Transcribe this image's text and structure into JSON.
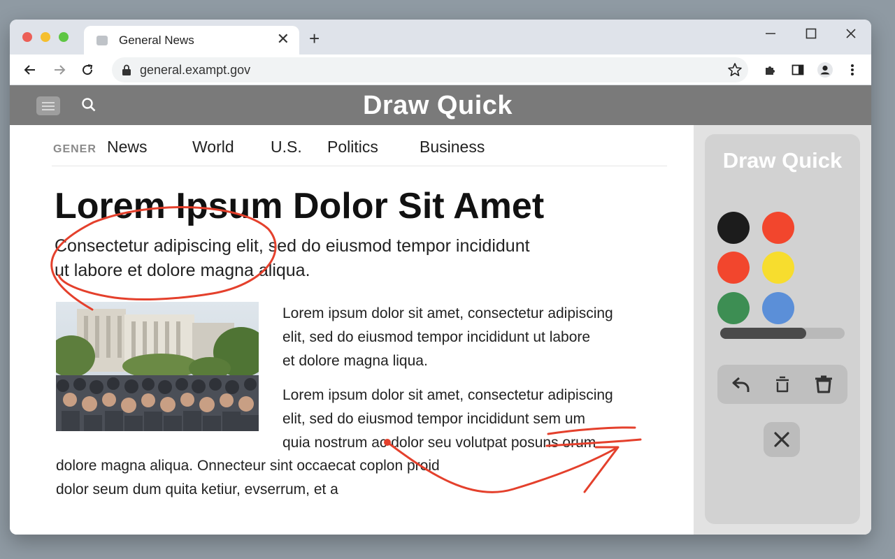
{
  "browser": {
    "tab_title": "General News",
    "url": "general.exampt.gov",
    "window_controls": [
      "minimize-icon",
      "maximize-icon",
      "close-icon"
    ],
    "traffic_lights": [
      "#ec5f57",
      "#f5bf2e",
      "#5ec644"
    ]
  },
  "site": {
    "title": "Draw Quick",
    "brand": "GENER",
    "nav": [
      "News",
      "World",
      "U.S.",
      "Politics",
      "Business"
    ]
  },
  "article": {
    "headline": "Lorem Ipsum Dolor Sit Amet",
    "subhead_lines": [
      "Consectetur adipiscing elit, sed do eiusmod tempor incididunt",
      "ut labore et dolore magna aliqua."
    ],
    "para1_lines": [
      "Lorem ipsum dolor sit amet, consectetur adipiscing",
      "elit, sed do eiusmod tempor incididunt ut labore",
      "et dolore magna liqua."
    ],
    "para2_lines": [
      "Lorem ipsum dolor sit amet, consectetur adipiscing",
      "elit, sed do eiusmod tempor incididunt sem um",
      "quia nostrum ac dolor seu volutpat posuns orum"
    ],
    "para3_lines": [
      "dolore magna aliqua. Onnecteur sint occaecat coplon proid",
      "dolor seum dum quita ketiur, evserrum, et a"
    ]
  },
  "panel": {
    "title": "Draw Quick",
    "colors": [
      "#1c1c1c",
      "#f2462d",
      "#f2462d",
      "#f7dd2e",
      "#3d8e53",
      "#5b8fd8"
    ],
    "brush_size_fraction": 0.69,
    "actions": [
      "undo-icon",
      "clear-icon",
      "delete-icon"
    ],
    "close": "close-icon"
  },
  "annotation_color": "#e4402c"
}
